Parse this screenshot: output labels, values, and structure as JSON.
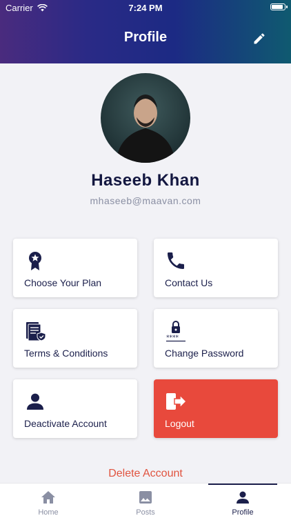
{
  "status_bar": {
    "carrier": "Carrier",
    "time": "7:24 PM"
  },
  "header": {
    "title": "Profile",
    "edit_icon": "pencil-icon"
  },
  "profile": {
    "name": "Haseeb Khan",
    "email": "mhaseeb@maavan.com"
  },
  "cards": [
    {
      "label": "Choose Your Plan",
      "icon": "award-ribbon-icon"
    },
    {
      "label": "Contact Us",
      "icon": "phone-icon"
    },
    {
      "label": "Terms & Conditions",
      "icon": "document-shield-icon"
    },
    {
      "label": "Change Password",
      "icon": "lock-password-icon"
    },
    {
      "label": "Deactivate Account",
      "icon": "person-icon"
    },
    {
      "label": "Logout",
      "icon": "logout-icon"
    }
  ],
  "delete_account": "Delete Account",
  "tabs": [
    {
      "label": "Home",
      "icon": "home-icon"
    },
    {
      "label": "Posts",
      "icon": "image-icon"
    },
    {
      "label": "Profile",
      "icon": "person-icon"
    }
  ],
  "colors": {
    "accent": "#1b1f4b",
    "logout": "#e8493c",
    "delete": "#e0533f"
  }
}
